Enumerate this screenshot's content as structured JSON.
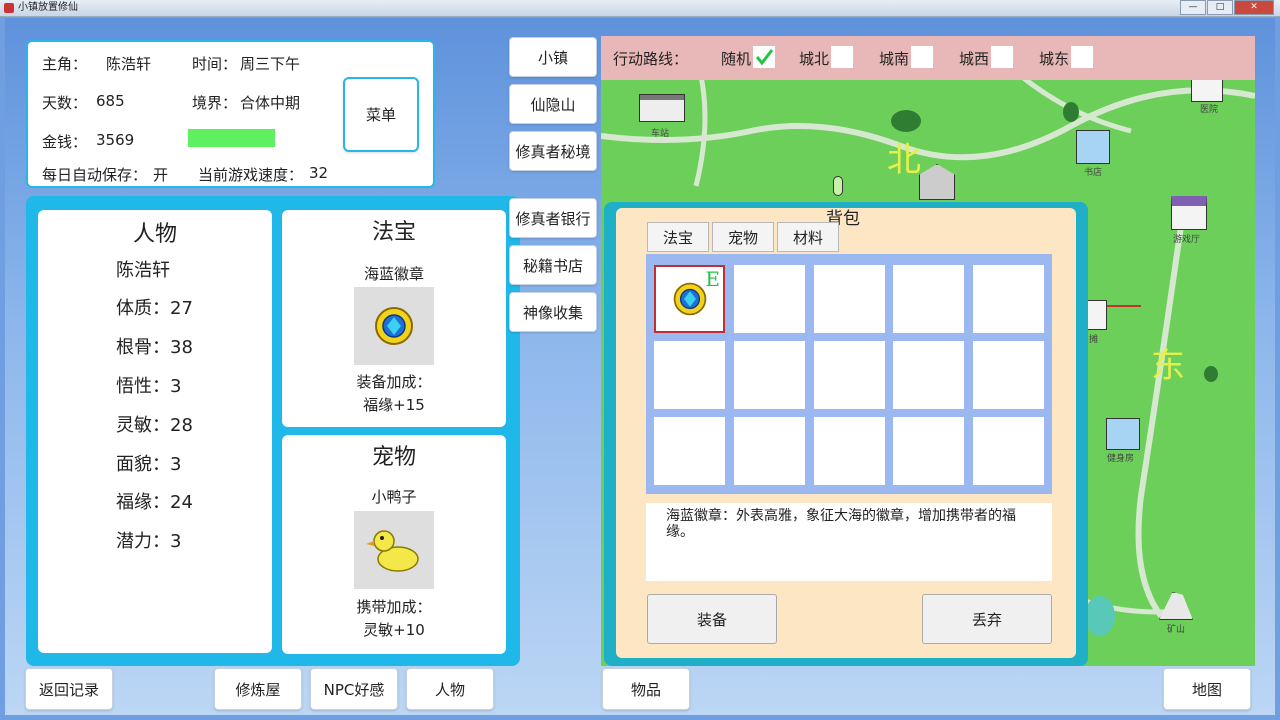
{
  "window": {
    "title": "小镇放置修仙",
    "controls": [
      "—",
      "□",
      "✕"
    ]
  },
  "info": {
    "protagonist_label": "主角：",
    "protagonist": "陈浩轩",
    "time_label": "时间：",
    "time": "周三下午",
    "days_label": "天数：",
    "days": "685",
    "realm_label": "境界：",
    "realm": "合体中期",
    "money_label": "金钱：",
    "money": "3569",
    "autosave_label": "每日自动保存：",
    "autosave": "开",
    "speed_label": "当前游戏速度：",
    "speed": "32",
    "menu_button": "菜单"
  },
  "character": {
    "title": "人物",
    "name": "陈浩轩",
    "stats": [
      {
        "label": "体质：",
        "value": "27"
      },
      {
        "label": "根骨：",
        "value": "38"
      },
      {
        "label": "悟性：",
        "value": "3"
      },
      {
        "label": "灵敏：",
        "value": "28"
      },
      {
        "label": "面貌：",
        "value": "3"
      },
      {
        "label": "福缘：",
        "value": "24"
      },
      {
        "label": "潜力：",
        "value": "3"
      }
    ]
  },
  "treasure": {
    "title": "法宝",
    "item_name": "海蓝徽章",
    "icon": "blue-gem-badge-icon",
    "bonus_label": "装备加成：",
    "bonus": "福缘+15"
  },
  "pet": {
    "title": "宠物",
    "item_name": "小鸭子",
    "icon": "duckling-icon",
    "bonus_label": "携带加成：",
    "bonus": "灵敏+10"
  },
  "nav": [
    "小镇",
    "仙隐山",
    "修真者秘境",
    "修真者银行",
    "秘籍书店",
    "神像收集"
  ],
  "route": {
    "label": "行动路线：",
    "options": [
      {
        "label": "随机",
        "checked": true
      },
      {
        "label": "城北",
        "checked": false
      },
      {
        "label": "城南",
        "checked": false
      },
      {
        "label": "城西",
        "checked": false
      },
      {
        "label": "城东",
        "checked": false
      }
    ]
  },
  "map": {
    "north": "北",
    "east": "东",
    "places": {
      "station": "车站",
      "hospital": "医院",
      "bookstore": "书店",
      "arcade": "游戏厅",
      "gym": "健身房",
      "mine": "矿山",
      "partial": "摊"
    }
  },
  "bag": {
    "title": "背包",
    "tabs": [
      "法宝",
      "宠物",
      "材料"
    ],
    "equipped_mark": "E",
    "description": "海蓝徽章：外表高雅，象征大海的徽章，增加携带者的福缘。",
    "equip_button": "装备",
    "discard_button": "丢弃"
  },
  "bottom": {
    "back": "返回记录",
    "training": "修炼屋",
    "npc": "NPC好感",
    "character": "人物",
    "items": "物品",
    "map": "地图"
  },
  "colors": {
    "accent": "#1fb8e8",
    "speed_bar": "#5ef05e",
    "map_grass": "#6ccf5a",
    "route_bar": "#e8b8b8",
    "bag_bg": "#fde6c4"
  }
}
